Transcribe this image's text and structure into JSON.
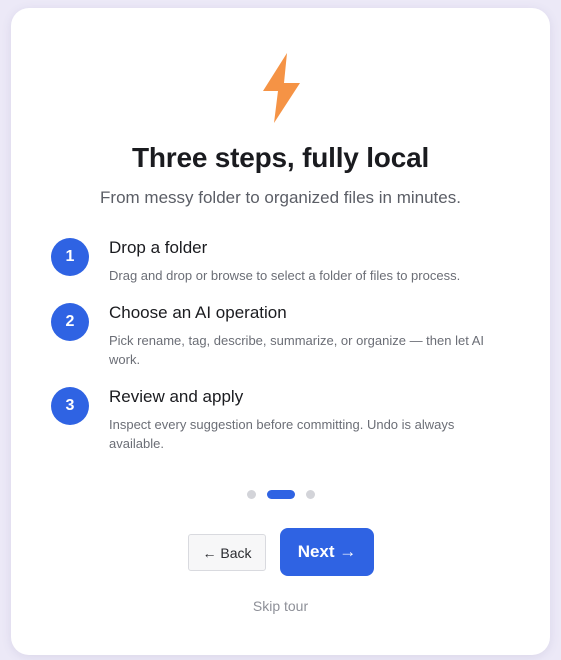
{
  "header": {
    "icon": "lightning-bolt-icon",
    "accent_color": "#f59345",
    "title": "Three steps, fully local",
    "subtitle": "From messy folder to organized files in minutes."
  },
  "steps": [
    {
      "number": "1",
      "title": "Drop a folder",
      "description": "Drag and drop or browse to select a folder of files to process."
    },
    {
      "number": "2",
      "title": "Choose an AI operation",
      "description": "Pick rename, tag, describe, summarize, or organize — then let AI work."
    },
    {
      "number": "3",
      "title": "Review and apply",
      "description": "Inspect every suggestion before committing. Undo is always available."
    }
  ],
  "pagination": {
    "total": 3,
    "current": 2
  },
  "actions": {
    "back_label": "← Back",
    "next_label": "Next →",
    "skip_label": "Skip tour"
  },
  "colors": {
    "primary": "#2f63e3",
    "background": "#ece9f7"
  }
}
